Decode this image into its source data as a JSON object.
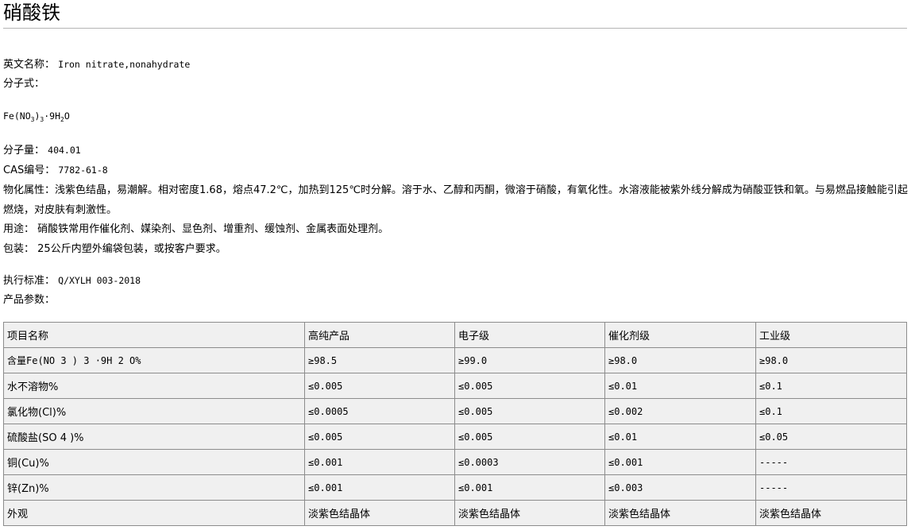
{
  "title": "硝酸铁",
  "english_name": {
    "label": "英文名称：",
    "value": "Iron nitrate,nonahydrate"
  },
  "formula_label": "分子式：",
  "formula": {
    "a": "Fe(NO",
    "s1": "3",
    "b": ")",
    "s2": "3",
    "c": "·9H",
    "s3": "2",
    "d": "O"
  },
  "molecular_weight": {
    "label": "分子量：",
    "value": "404.01"
  },
  "cas": {
    "label": "CAS编号：",
    "value": "7782-61-8"
  },
  "properties": {
    "label": "物化属性：",
    "value": "浅紫色结晶，易潮解。相对密度1.68，熔点47.2℃，加热到125℃时分解。溶于水、乙醇和丙酮，微溶于硝酸，有氧化性。水溶液能被紫外线分解成为硝酸亚铁和氧。与易燃品接触能引起燃烧，对皮肤有刺激性。"
  },
  "usage": {
    "label": "用途：",
    "value": "硝酸铁常用作催化剂、媒染剂、显色剂、增重剂、缓蚀剂、金属表面处理剂。"
  },
  "packaging": {
    "label": "包装：",
    "value": "25公斤内塑外编袋包装，或按客户要求。"
  },
  "standard": {
    "label": "执行标准：",
    "value": "Q/XYLH 003-2018"
  },
  "params_label": "产品参数：",
  "table": {
    "header": [
      "项目名称",
      "高纯产品",
      "电子级",
      "催化剂级",
      "工业级"
    ],
    "rows": [
      [
        "含量Fe(NO 3 ) 3 ·9H 2 O%",
        "≥98.5",
        "≥99.0",
        "≥98.0",
        "≥98.0"
      ],
      [
        "水不溶物%",
        "≤0.005",
        "≤0.005",
        "≤0.01",
        "≤0.1"
      ],
      [
        "氯化物(Cl)%",
        "≤0.0005",
        "≤0.005",
        "≤0.002",
        "≤0.1"
      ],
      [
        "硫酸盐(SO 4 )%",
        "≤0.005",
        "≤0.005",
        "≤0.01",
        "≤0.05"
      ],
      [
        "铜(Cu)%",
        "≤0.001",
        "≤0.0003",
        "≤0.001",
        "-----"
      ],
      [
        "锌(Zn)%",
        "≤0.001",
        "≤0.001",
        "≤0.003",
        "-----"
      ],
      [
        "外观",
        "淡紫色结晶体",
        "淡紫色结晶体",
        "淡紫色结晶体",
        "淡紫色结晶体"
      ]
    ]
  }
}
